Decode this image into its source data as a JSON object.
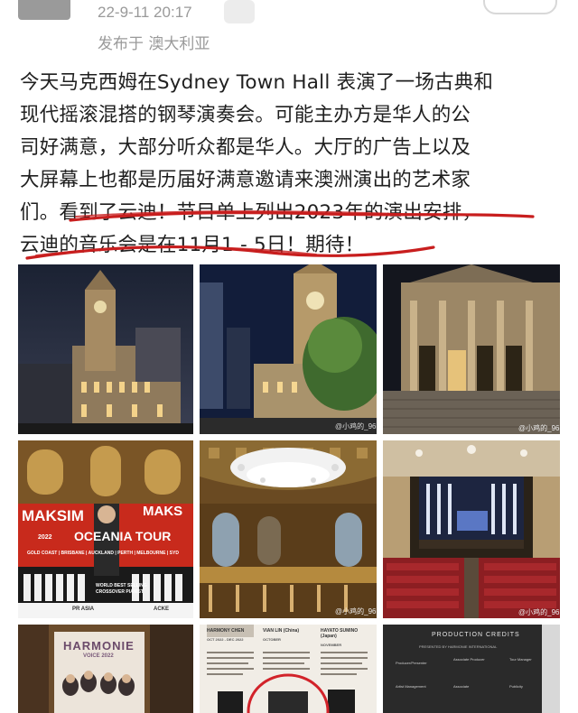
{
  "post": {
    "timestamp": "22-9-11 20:17",
    "location": "发布于 澳大利亚",
    "lines": [
      "今天马克西姆在Sydney Town Hall 表演了一场古典和",
      "现代摇滚混搭的钢琴演奏会。可能主办方是华人的公",
      "司好满意，大部分听众都是华人。大厅的广告上以及",
      "大屏幕上也都是历届好满意邀请来澳洲演出的艺术家",
      "们。看到了云迪！节目单上列出2023年的演出安排，",
      "云迪的音乐会是在11月1 - 5日！期待！"
    ]
  },
  "photos": {
    "poster": {
      "name_left": "MAKSIM",
      "name_right": "MAKS",
      "tour": "OCEANIA TOUR",
      "year": "2022",
      "cities": "GOLD COAST | BRISBANE | AUCKLAND | PERTH | MELBOURNE | SYD",
      "tagline": "WORLD BEST SELLING CROSSOVER PIANIST",
      "sponsor_left": "PR ASIA",
      "sponsor_right": "ACKE"
    },
    "harmonie": {
      "title": "HARMONIE",
      "sub": "VOICE 2022"
    },
    "program": {
      "col1": "HARMONY CHEN",
      "col2": "VIAN LIN (China)",
      "col3": "HAYATO SUMINO (Japan)",
      "date1": "OCT 2022 - DEC 2022",
      "date2": "OCTOBER",
      "date3": "NOVEMBER"
    },
    "credits": {
      "title": "PRODUCTION CREDITS",
      "presented": "PRESENTED BY HARMONIE INTERNATIONAL",
      "rows": [
        "Producer/Presenter",
        "Associate Producer",
        "Tour Manager",
        "Artist Management",
        "Associate",
        "Publicity"
      ]
    },
    "watermark": "@小鸡的_96"
  },
  "colors": {
    "underline": "#c81e1e",
    "text": "#1f1f1f",
    "meta": "#9a9a9a"
  }
}
